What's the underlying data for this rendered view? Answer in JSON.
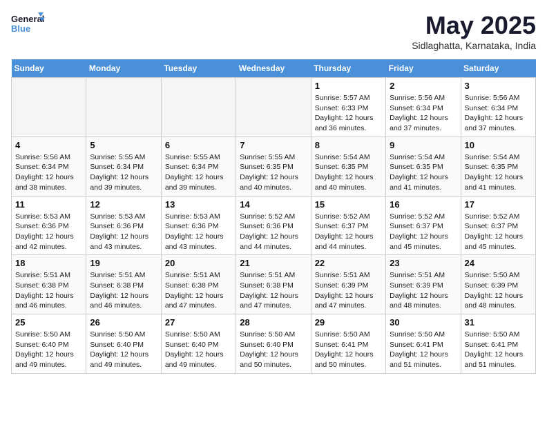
{
  "header": {
    "logo_line1": "General",
    "logo_line2": "Blue",
    "month": "May 2025",
    "location": "Sidlaghatta, Karnataka, India"
  },
  "weekdays": [
    "Sunday",
    "Monday",
    "Tuesday",
    "Wednesday",
    "Thursday",
    "Friday",
    "Saturday"
  ],
  "weeks": [
    [
      {
        "day": "",
        "info": ""
      },
      {
        "day": "",
        "info": ""
      },
      {
        "day": "",
        "info": ""
      },
      {
        "day": "",
        "info": ""
      },
      {
        "day": "1",
        "info": "Sunrise: 5:57 AM\nSunset: 6:33 PM\nDaylight: 12 hours\nand 36 minutes."
      },
      {
        "day": "2",
        "info": "Sunrise: 5:56 AM\nSunset: 6:34 PM\nDaylight: 12 hours\nand 37 minutes."
      },
      {
        "day": "3",
        "info": "Sunrise: 5:56 AM\nSunset: 6:34 PM\nDaylight: 12 hours\nand 37 minutes."
      }
    ],
    [
      {
        "day": "4",
        "info": "Sunrise: 5:56 AM\nSunset: 6:34 PM\nDaylight: 12 hours\nand 38 minutes."
      },
      {
        "day": "5",
        "info": "Sunrise: 5:55 AM\nSunset: 6:34 PM\nDaylight: 12 hours\nand 39 minutes."
      },
      {
        "day": "6",
        "info": "Sunrise: 5:55 AM\nSunset: 6:34 PM\nDaylight: 12 hours\nand 39 minutes."
      },
      {
        "day": "7",
        "info": "Sunrise: 5:55 AM\nSunset: 6:35 PM\nDaylight: 12 hours\nand 40 minutes."
      },
      {
        "day": "8",
        "info": "Sunrise: 5:54 AM\nSunset: 6:35 PM\nDaylight: 12 hours\nand 40 minutes."
      },
      {
        "day": "9",
        "info": "Sunrise: 5:54 AM\nSunset: 6:35 PM\nDaylight: 12 hours\nand 41 minutes."
      },
      {
        "day": "10",
        "info": "Sunrise: 5:54 AM\nSunset: 6:35 PM\nDaylight: 12 hours\nand 41 minutes."
      }
    ],
    [
      {
        "day": "11",
        "info": "Sunrise: 5:53 AM\nSunset: 6:36 PM\nDaylight: 12 hours\nand 42 minutes."
      },
      {
        "day": "12",
        "info": "Sunrise: 5:53 AM\nSunset: 6:36 PM\nDaylight: 12 hours\nand 43 minutes."
      },
      {
        "day": "13",
        "info": "Sunrise: 5:53 AM\nSunset: 6:36 PM\nDaylight: 12 hours\nand 43 minutes."
      },
      {
        "day": "14",
        "info": "Sunrise: 5:52 AM\nSunset: 6:36 PM\nDaylight: 12 hours\nand 44 minutes."
      },
      {
        "day": "15",
        "info": "Sunrise: 5:52 AM\nSunset: 6:37 PM\nDaylight: 12 hours\nand 44 minutes."
      },
      {
        "day": "16",
        "info": "Sunrise: 5:52 AM\nSunset: 6:37 PM\nDaylight: 12 hours\nand 45 minutes."
      },
      {
        "day": "17",
        "info": "Sunrise: 5:52 AM\nSunset: 6:37 PM\nDaylight: 12 hours\nand 45 minutes."
      }
    ],
    [
      {
        "day": "18",
        "info": "Sunrise: 5:51 AM\nSunset: 6:38 PM\nDaylight: 12 hours\nand 46 minutes."
      },
      {
        "day": "19",
        "info": "Sunrise: 5:51 AM\nSunset: 6:38 PM\nDaylight: 12 hours\nand 46 minutes."
      },
      {
        "day": "20",
        "info": "Sunrise: 5:51 AM\nSunset: 6:38 PM\nDaylight: 12 hours\nand 47 minutes."
      },
      {
        "day": "21",
        "info": "Sunrise: 5:51 AM\nSunset: 6:38 PM\nDaylight: 12 hours\nand 47 minutes."
      },
      {
        "day": "22",
        "info": "Sunrise: 5:51 AM\nSunset: 6:39 PM\nDaylight: 12 hours\nand 47 minutes."
      },
      {
        "day": "23",
        "info": "Sunrise: 5:51 AM\nSunset: 6:39 PM\nDaylight: 12 hours\nand 48 minutes."
      },
      {
        "day": "24",
        "info": "Sunrise: 5:50 AM\nSunset: 6:39 PM\nDaylight: 12 hours\nand 48 minutes."
      }
    ],
    [
      {
        "day": "25",
        "info": "Sunrise: 5:50 AM\nSunset: 6:40 PM\nDaylight: 12 hours\nand 49 minutes."
      },
      {
        "day": "26",
        "info": "Sunrise: 5:50 AM\nSunset: 6:40 PM\nDaylight: 12 hours\nand 49 minutes."
      },
      {
        "day": "27",
        "info": "Sunrise: 5:50 AM\nSunset: 6:40 PM\nDaylight: 12 hours\nand 49 minutes."
      },
      {
        "day": "28",
        "info": "Sunrise: 5:50 AM\nSunset: 6:40 PM\nDaylight: 12 hours\nand 50 minutes."
      },
      {
        "day": "29",
        "info": "Sunrise: 5:50 AM\nSunset: 6:41 PM\nDaylight: 12 hours\nand 50 minutes."
      },
      {
        "day": "30",
        "info": "Sunrise: 5:50 AM\nSunset: 6:41 PM\nDaylight: 12 hours\nand 51 minutes."
      },
      {
        "day": "31",
        "info": "Sunrise: 5:50 AM\nSunset: 6:41 PM\nDaylight: 12 hours\nand 51 minutes."
      }
    ]
  ]
}
